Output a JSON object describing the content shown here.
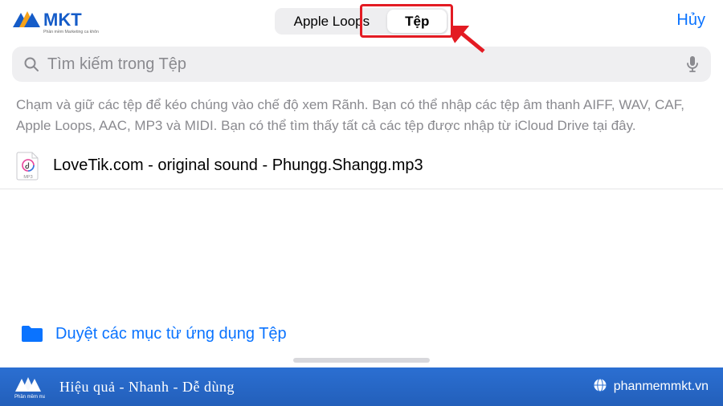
{
  "brand": {
    "name": "MKT",
    "tagline_main": "Phần mềm Marketing ca khôn"
  },
  "header": {
    "cancel": "Hủy",
    "seg_apple_loops": "Apple Loops",
    "seg_files": "Tệp"
  },
  "search": {
    "placeholder": "Tìm kiếm trong Tệp"
  },
  "help": "Chạm và giữ các tệp để kéo chúng vào chế độ xem Rãnh. Bạn có thể nhập các tệp âm thanh AIFF, WAV, CAF, Apple Loops, AAC, MP3 và MIDI. Bạn có thể tìm thấy tất cả các tệp được nhập từ iCloud Drive tại đây.",
  "file": {
    "name": "LoveTik.com - original sound - Phungg.Shangg.mp3",
    "badge": "MP3"
  },
  "browse": {
    "label": "Duyệt các mục từ ứng dụng Tệp"
  },
  "footer": {
    "tagline": "Hiệu quả - Nhanh  - Dễ dùng",
    "site": "phanmemmkt.vn"
  }
}
